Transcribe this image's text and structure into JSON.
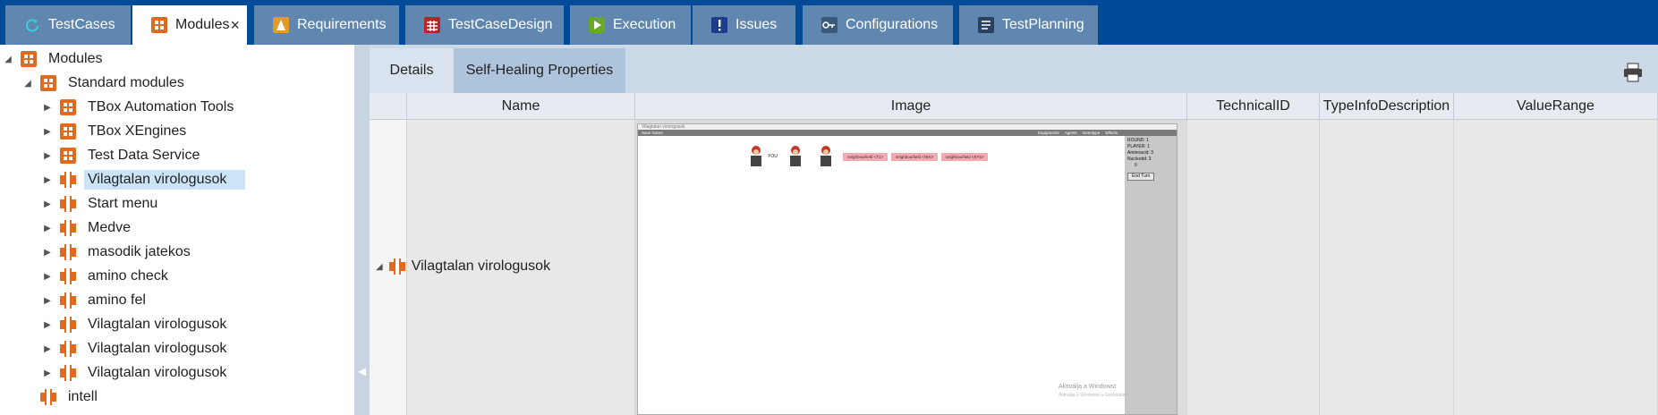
{
  "top_tabs": [
    {
      "label": "TestCases",
      "icon": "refresh-icon",
      "color": "#1aa6b7"
    },
    {
      "label": "Modules",
      "icon": "module-icon",
      "color": "#e06a1e"
    },
    {
      "label": "Requirements",
      "icon": "requirements-icon",
      "color": "#e09c1e"
    },
    {
      "label": "TestCaseDesign",
      "icon": "table-icon",
      "color": "#b82525"
    },
    {
      "label": "Execution",
      "icon": "play-icon",
      "color": "#6aa82a"
    },
    {
      "label": "Issues",
      "icon": "exclamation-icon",
      "color": "#1e3c8c"
    },
    {
      "label": "Configurations",
      "icon": "key-icon",
      "color": "#3a5a7a"
    },
    {
      "label": "TestPlanning",
      "icon": "list-icon",
      "color": "#2a4060"
    }
  ],
  "close_glyph": "×",
  "tree": {
    "root": "Modules",
    "standard": "Standard modules",
    "folders": [
      "TBox Automation Tools",
      "TBox XEngines",
      "Test Data Service"
    ],
    "modules": [
      "Vilagtalan virologusok",
      "Start menu",
      "Medve",
      "masodik jatekos",
      "amino check",
      "amino fel",
      "Vilagtalan virologusok",
      "Vilagtalan virologusok",
      "Vilagtalan virologusok"
    ],
    "extra": "intell"
  },
  "subtabs": {
    "details": "Details",
    "self_healing": "Self-Healing Properties"
  },
  "grid": {
    "columns": [
      "Name",
      "Image",
      "TechnicalID",
      "TypeInfoDescription",
      "ValueRange"
    ],
    "row_name": "Vilagtalan virologusok"
  },
  "thumbnail": {
    "title": "Vilagtalan virologusok",
    "you_label": "YOU",
    "pink_buttons": [
      "neighbourfield <T1>",
      "neighbourfield <NHt>",
      "neighbourfield <ET5>"
    ],
    "side_lines": [
      "ROUND: 1",
      "PLAYER: 1",
      "Aminoacid: 3",
      "Nucleotid: 3",
      "0"
    ],
    "end_turn": "End Turn",
    "menu_items": [
      "Save Game",
      "Equipments",
      "Agents",
      "Genotype",
      "Effects"
    ],
    "watermark_title": "Aktiválja a Windowst",
    "watermark_sub": "Aktiválja a Windowst a Gépházban"
  },
  "colors": {
    "brand": "#004a98",
    "tab_inactive": "#5f87b0",
    "module_orange": "#e06a1e",
    "selection": "#cce4f7"
  }
}
